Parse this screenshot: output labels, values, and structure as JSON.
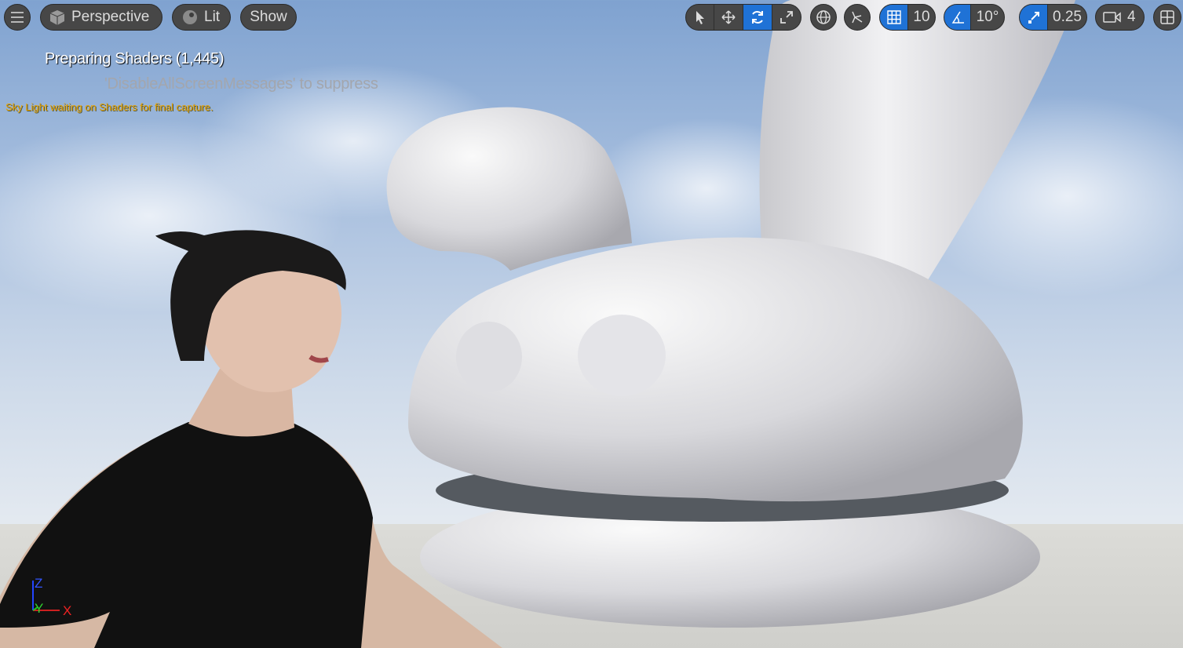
{
  "toolbar": {
    "view_mode": "Perspective",
    "lighting": "Lit",
    "show": "Show",
    "grid_snap": "10",
    "rotation_snap": "10°",
    "scale_snap": "0.25",
    "camera_speed": "4"
  },
  "messages": {
    "shaders": "Preparing Shaders (1,445)",
    "suppress": "'DisableAllScreenMessages' to suppress",
    "skylight": "Sky Light waiting on Shaders for final capture."
  },
  "axes": {
    "z": "Z",
    "y": "Y",
    "x": "X"
  },
  "colors": {
    "accent": "#1f72d6",
    "warning": "#e8a400"
  }
}
